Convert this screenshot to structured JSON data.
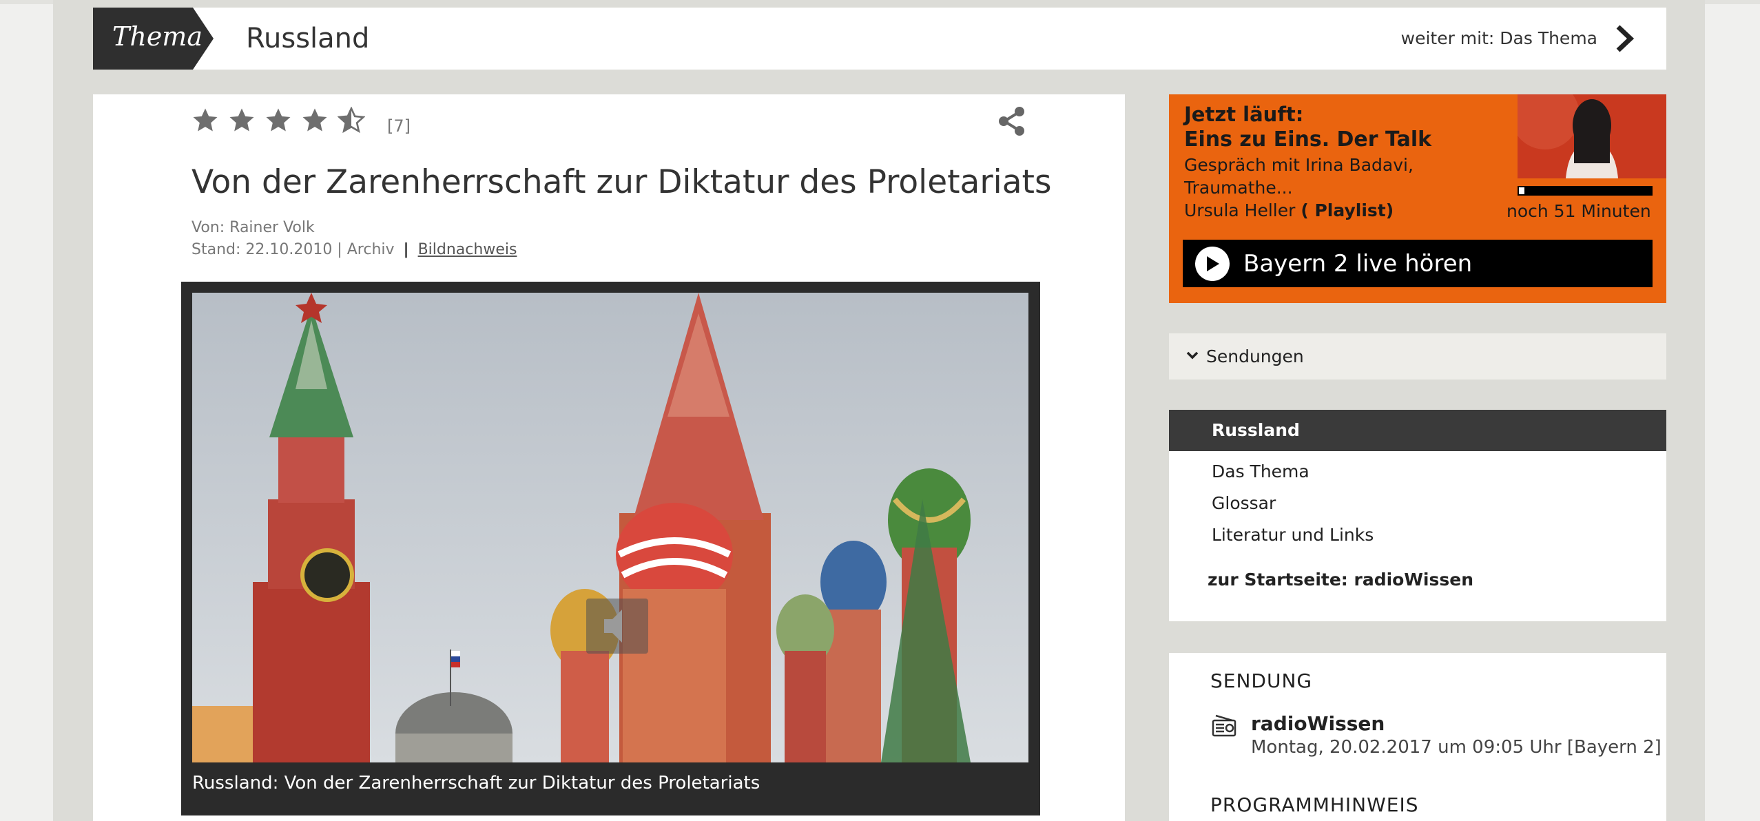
{
  "header": {
    "tag": "Thema",
    "title": "Russland",
    "next_label": "weiter mit: Das Thema"
  },
  "article": {
    "rating": {
      "stars": 4.5,
      "max": 5,
      "count_label": "[7]"
    },
    "title": "Von der Zarenherrschaft zur Diktatur des Proletariats",
    "author_line": "Von: Rainer Volk",
    "stand_line": "Stand: 22.10.2010 | Archiv",
    "separator": "|",
    "image_credit_link": "Bildnachweis",
    "caption": "Russland: Von der Zarenherrschaft zur Diktatur des Proletariats"
  },
  "now_playing": {
    "label": "Jetzt läuft:",
    "show": "Eins zu Eins. Der Talk",
    "description": "Gespräch mit Irina Badavi, Traumathe...",
    "host": "Ursula Heller",
    "playlist_link": "( Playlist)",
    "progress_fraction": 0.04,
    "remaining": "noch 51 Minuten",
    "live_button": "Bayern 2 live hören",
    "accent_color": "#ea640f"
  },
  "sendungen": {
    "label": "Sendungen"
  },
  "nav": {
    "active": "Russland",
    "items": [
      "Das Thema",
      "Glossar",
      "Literatur und Links"
    ],
    "home_link": "zur Startseite: radioWissen"
  },
  "program": {
    "heading": "SENDUNG",
    "name": "radioWissen",
    "date": "Montag, 20.02.2017 um 09:05 Uhr [Bayern 2]",
    "hint_heading": "PROGRAMMHINWEIS"
  }
}
